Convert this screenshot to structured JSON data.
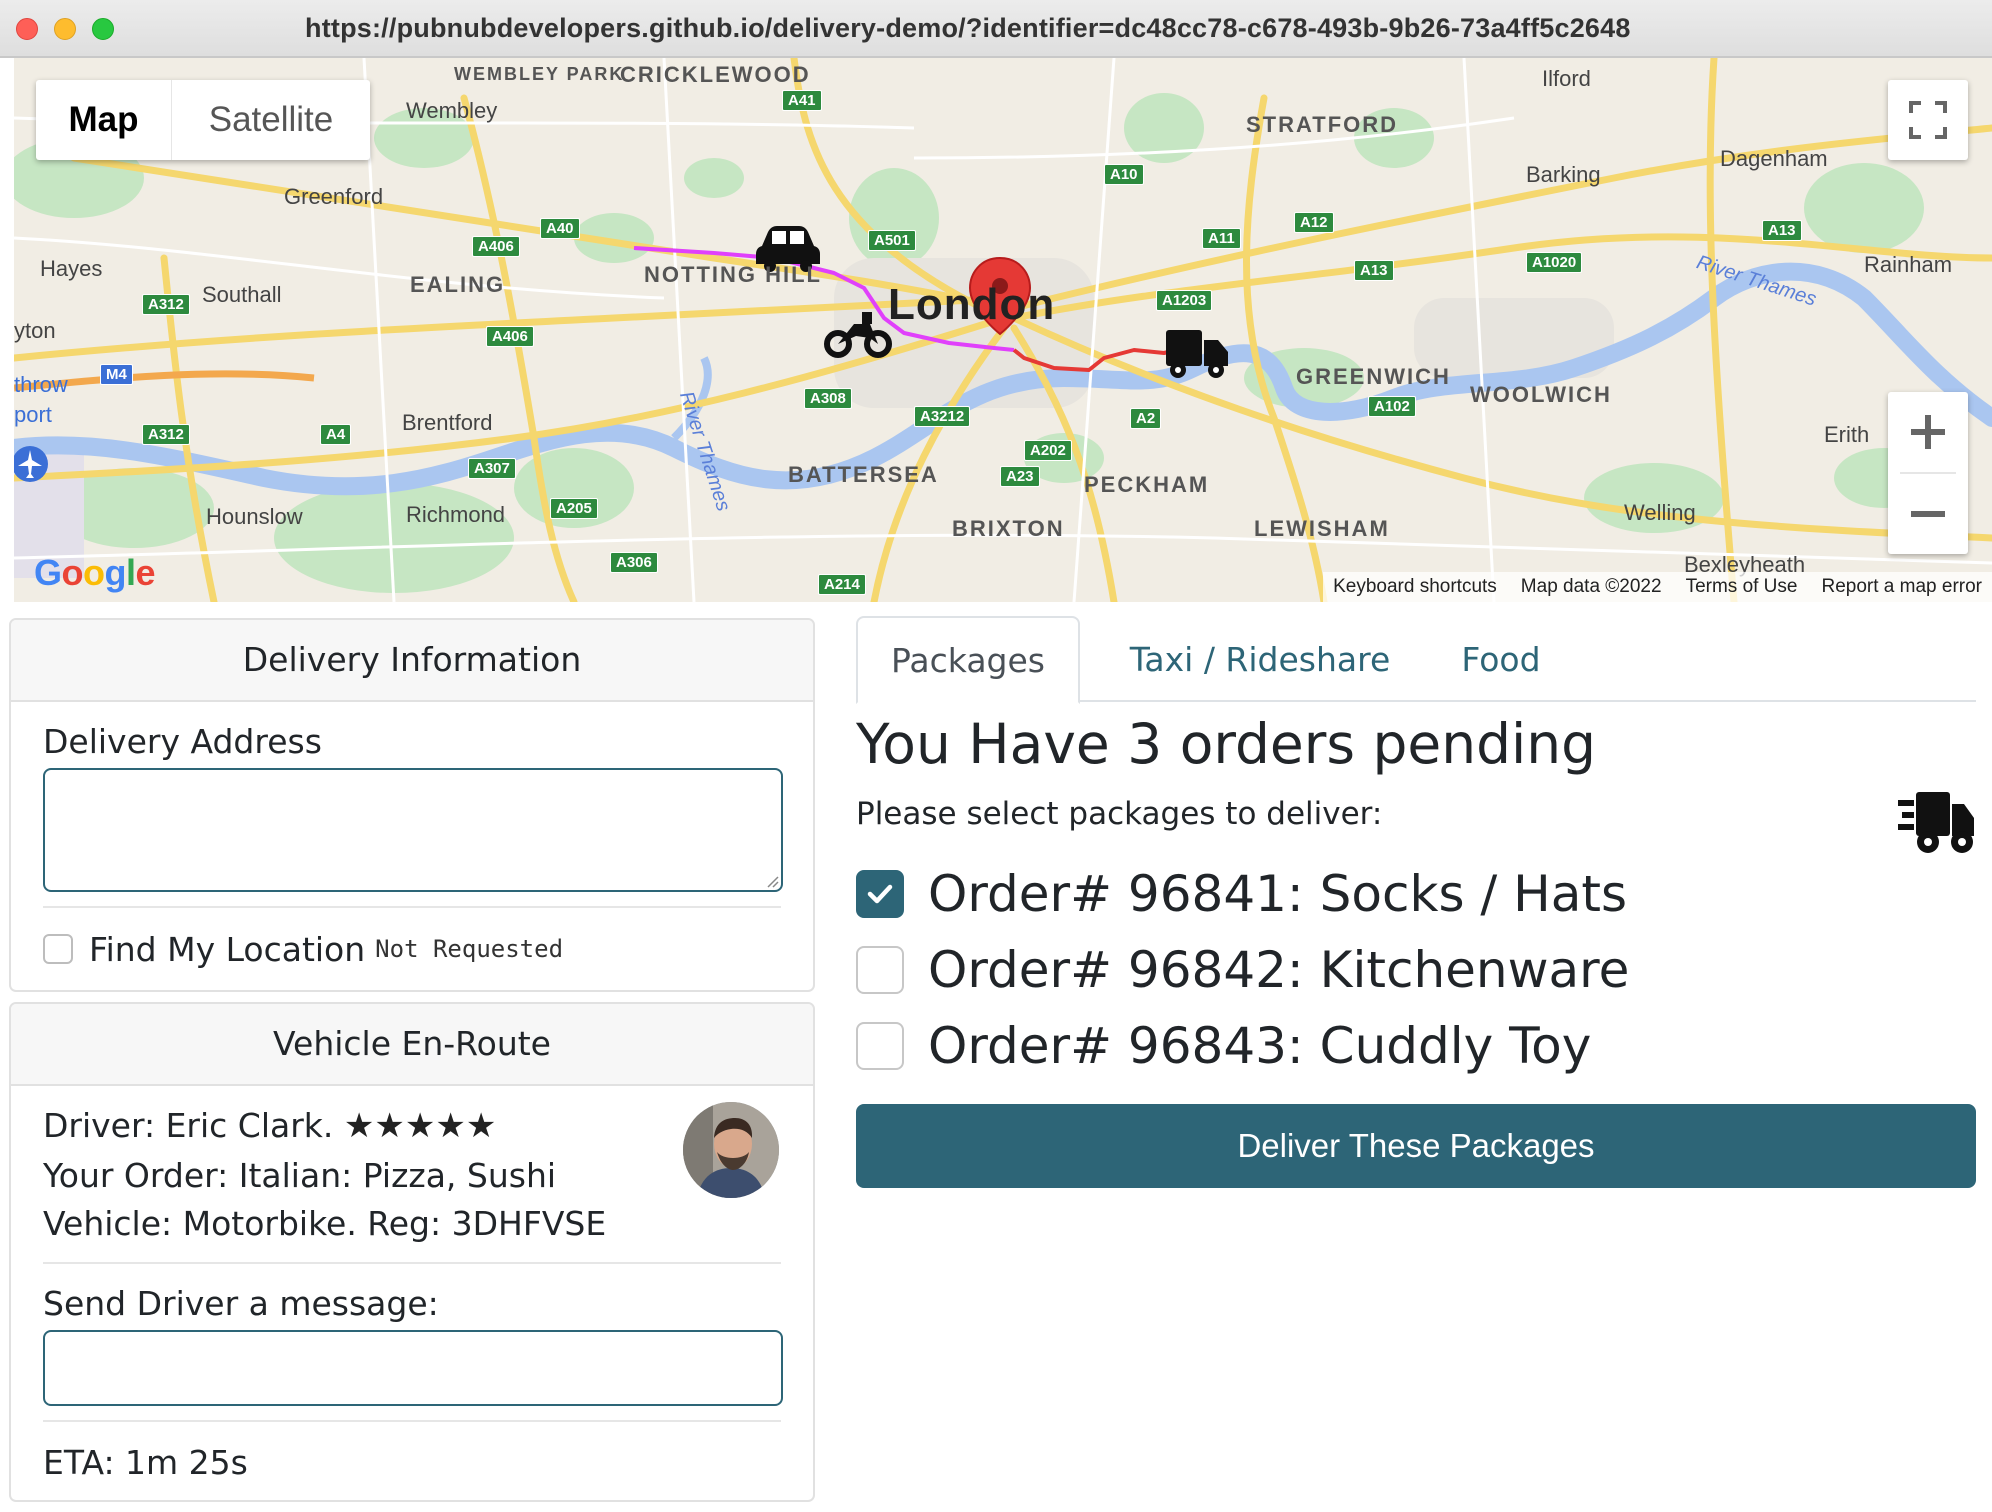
{
  "browser": {
    "url": "https://pubnubdevelopers.github.io/delivery-demo/?identifier=dc48cc78-c678-493b-9b26-73a4ff5c2648"
  },
  "map": {
    "type_buttons": {
      "map": "Map",
      "satellite": "Satellite"
    },
    "places_big": [
      "WEMBLEY PARK",
      "CRICKLEWOOD",
      "STRATFORD",
      "EALING",
      "NOTTING HILL",
      "GREENWICH",
      "WOOLWICH",
      "BATTERSEA",
      "PECKHAM",
      "BRIXTON",
      "LEWISHAM"
    ],
    "places_small": [
      "Wembley",
      "Ilford",
      "Dagenham",
      "Barking",
      "Greenford",
      "Hayes",
      "Southall",
      "Rainham",
      "yton",
      "throw",
      "port",
      "Brentford",
      "Erith",
      "Hounslow",
      "Richmond",
      "Welling",
      "Bexleyheath"
    ],
    "city_label": "London",
    "river_labels": [
      "River Thames",
      "River Thames"
    ],
    "roads": [
      "A41",
      "A40",
      "A10",
      "A12",
      "A11",
      "A13",
      "A1020",
      "A406",
      "A501",
      "A312",
      "A1203",
      "M4",
      "A406",
      "A308",
      "A3212",
      "A2",
      "A102",
      "A312",
      "A4",
      "A307",
      "A202",
      "A23",
      "A205",
      "A306",
      "A214",
      "A13"
    ],
    "attribution": [
      "Keyboard shortcuts",
      "Map data ©2022",
      "Terms of Use",
      "Report a map error"
    ],
    "logo": "Google",
    "colors": {
      "route_pink": "#e040fb",
      "route_red": "#e53935",
      "marker": "#e53935",
      "water": "#aac6f0"
    }
  },
  "delivery_info": {
    "header": "Delivery Information",
    "address_label": "Delivery Address",
    "address_value": "",
    "find_location_label": "Find My Location",
    "find_location_status": "Not Requested"
  },
  "vehicle": {
    "header": "Vehicle En-Route",
    "driver": "Driver: Eric Clark.",
    "rating_stars": 5,
    "stars_text": "★★★★★",
    "order": "Your Order: Italian: Pizza, Sushi",
    "vehicle": "Vehicle: Motorbike. Reg: 3DHFVSE",
    "message_label": "Send Driver a message:",
    "message_value": "",
    "eta": "ETA: 1m 25s"
  },
  "tabs": [
    {
      "label": "Packages",
      "active": true
    },
    {
      "label": "Taxi / Rideshare",
      "active": false
    },
    {
      "label": "Food",
      "active": false
    }
  ],
  "packages": {
    "headline": "You Have 3 orders pending",
    "subline": "Please select packages to deliver:",
    "orders": [
      {
        "label": "Order# 96841: Socks / Hats",
        "checked": true
      },
      {
        "label": "Order# 96842: Kitchenware",
        "checked": false
      },
      {
        "label": "Order# 96843: Cuddly Toy",
        "checked": false
      }
    ],
    "button": "Deliver These Packages"
  },
  "colors": {
    "accent": "#2d6577"
  }
}
